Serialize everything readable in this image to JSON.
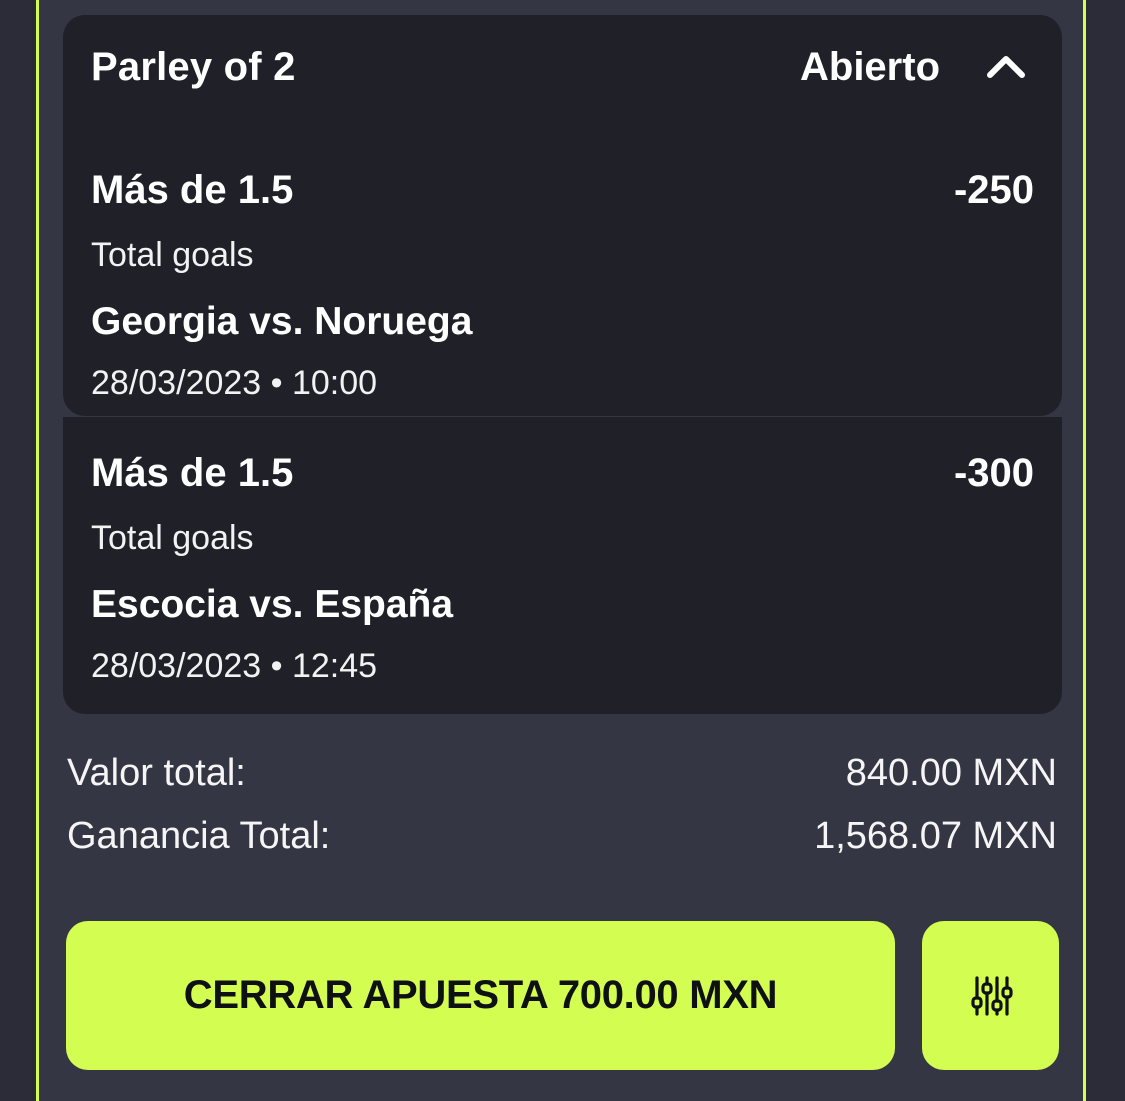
{
  "ticket": {
    "title": "Parley of 2",
    "status": "Abierto",
    "legs": [
      {
        "market": "Más de 1.5",
        "odds": "-250",
        "market_type": "Total goals",
        "match": "Georgia vs. Noruega",
        "datetime": "28/03/2023 • 10:00"
      },
      {
        "market": "Más de 1.5",
        "odds": "-300",
        "market_type": "Total goals",
        "match": "Escocia vs. España",
        "datetime": "28/03/2023 • 12:45"
      }
    ]
  },
  "summary": {
    "total_value_label": "Valor total:",
    "total_value": "840.00 MXN",
    "total_gain_label": "Ganancia Total:",
    "total_gain": "1,568.07 MXN"
  },
  "actions": {
    "cashout_label": "CERRAR APUESTA 700.00 MXN",
    "settings_icon": "sliders-icon"
  },
  "colors": {
    "accent": "#d4fd52",
    "card": "#1f2028",
    "background": "#353643"
  }
}
